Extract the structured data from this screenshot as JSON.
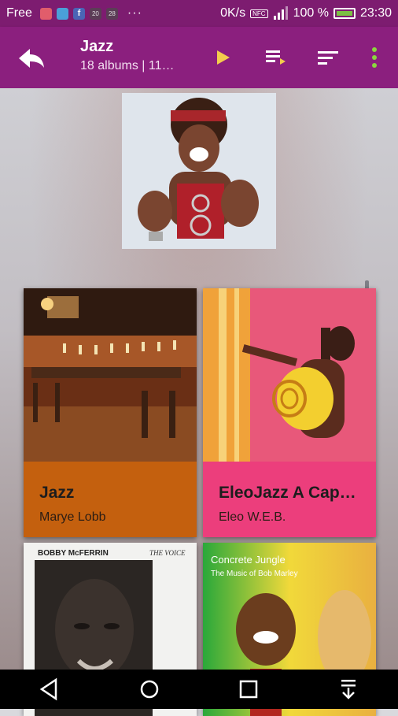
{
  "status_bar": {
    "carrier": "Free",
    "notification_icons": [
      "email-icon",
      "image-icon",
      "facebook-icon",
      "calendar-icon",
      "calendar-icon"
    ],
    "cal1": "20",
    "cal2": "28",
    "overflow": "···",
    "net_speed": "0K/s",
    "nfc": "NFC",
    "battery_pct": "100 %",
    "time": "23:30"
  },
  "toolbar": {
    "title": "Jazz",
    "subtitle": "18 albums | 11…"
  },
  "albums": [
    {
      "title": "Jazz",
      "artist": "Marye Lobb"
    },
    {
      "title": "EleoJazz A Cap…",
      "artist": "Eleo W.E.B."
    },
    {
      "cover_top_left": "BOBBY McFERRIN",
      "cover_top_right": "THE VOICE"
    },
    {
      "cover_title": "Concrete Jungle",
      "cover_subtitle": "The Music of Bob Marley"
    }
  ],
  "colors": {
    "status_bar": "#7d1c70",
    "toolbar": "#8b1f7e",
    "accent": "#f3cc4d",
    "album1_meta": "#c4600e",
    "album2_meta": "#ec3e7c"
  }
}
